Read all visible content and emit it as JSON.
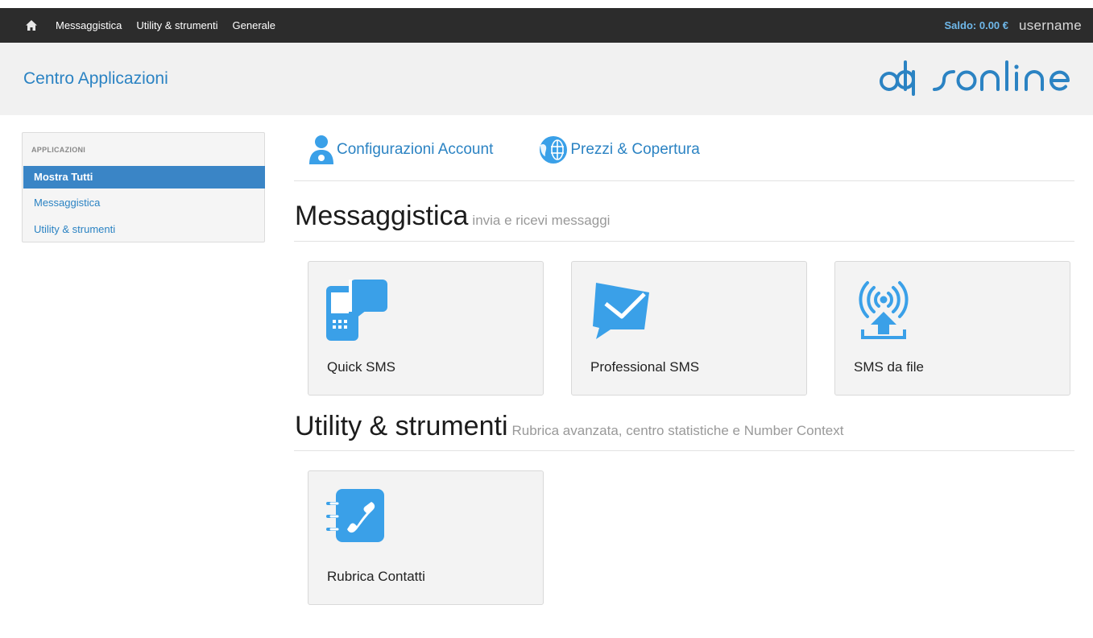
{
  "navbar": {
    "home_icon": "home-icon",
    "links": [
      "Messaggistica",
      "Utility & strumenti",
      "Generale"
    ],
    "saldo": "Saldo: 0.00 €",
    "username": "username"
  },
  "header": {
    "title": "Centro Applicazioni",
    "logo_text": "dpsonline"
  },
  "sidebar": {
    "heading": "APPLICAZIONI",
    "items": [
      {
        "label": "Mostra Tutti",
        "active": true
      },
      {
        "label": "Messaggistica",
        "active": false
      },
      {
        "label": "Utility & strumenti",
        "active": false
      }
    ]
  },
  "toplinks": [
    {
      "label": "Configurazioni Account",
      "icon": "user-icon"
    },
    {
      "label": "Prezzi & Copertura",
      "icon": "globe-icon"
    }
  ],
  "sections": [
    {
      "title": "Messaggistica",
      "subtitle": "invia e ricevi messaggi",
      "cards": [
        {
          "label": "Quick SMS",
          "icon": "phone-chat-icon"
        },
        {
          "label": "Professional SMS",
          "icon": "envelope-chat-icon"
        },
        {
          "label": "SMS da file",
          "icon": "broadcast-upload-icon"
        }
      ]
    },
    {
      "title": "Utility & strumenti",
      "subtitle": "Rubrica avanzata, centro statistiche e Number Context",
      "cards": [
        {
          "label": "Rubrica Contatti",
          "icon": "address-book-icon"
        }
      ]
    }
  ],
  "colors": {
    "accent": "#2b83c3",
    "icon_blue": "#3aa0e8",
    "navbar_bg": "#2c2c2c",
    "active_bg": "#3a85c6"
  }
}
